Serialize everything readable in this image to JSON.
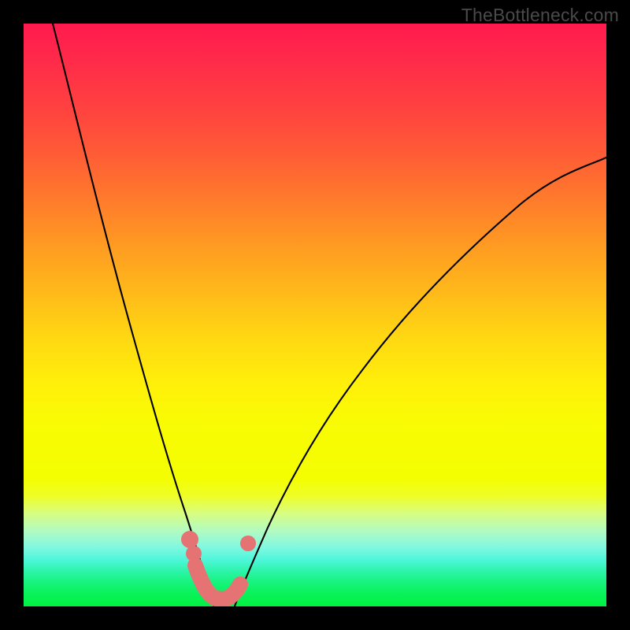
{
  "watermark": "TheBottleneck.com",
  "colors": {
    "background": "#000000",
    "curve": "#000000",
    "squiggle": "#e57373",
    "gradient_top": "#ff1a4d",
    "gradient_bottom": "#02f142"
  },
  "chart_data": {
    "type": "line",
    "title": "",
    "xlabel": "",
    "ylabel": "",
    "xlim": [
      0,
      100
    ],
    "ylim": [
      0,
      100
    ],
    "grid": false,
    "legend": false,
    "background": "vertical-gradient red→yellow→green",
    "series": [
      {
        "name": "left-curve",
        "x": [
          5,
          10,
          15,
          20,
          23,
          26,
          28,
          30,
          32,
          32.5
        ],
        "y": [
          100,
          80,
          58,
          36,
          25,
          16,
          10,
          4,
          1,
          0
        ]
      },
      {
        "name": "right-curve",
        "x": [
          36,
          38,
          41,
          46,
          52,
          60,
          70,
          82,
          96,
          100
        ],
        "y": [
          0,
          2,
          6,
          14,
          24,
          36,
          49,
          62,
          74,
          77
        ]
      },
      {
        "name": "valley-squiggle",
        "x": [
          28.5,
          29.0,
          29.5,
          30.5,
          32.0,
          33.5,
          35.0,
          36.0,
          37.0,
          38.5
        ],
        "y": [
          12,
          9.5,
          7.5,
          4.0,
          2.0,
          2.0,
          2.5,
          4.0,
          7.0,
          11.5
        ]
      }
    ],
    "annotations": [
      {
        "text": "TheBottleneck.com",
        "position": "top-right"
      }
    ]
  }
}
